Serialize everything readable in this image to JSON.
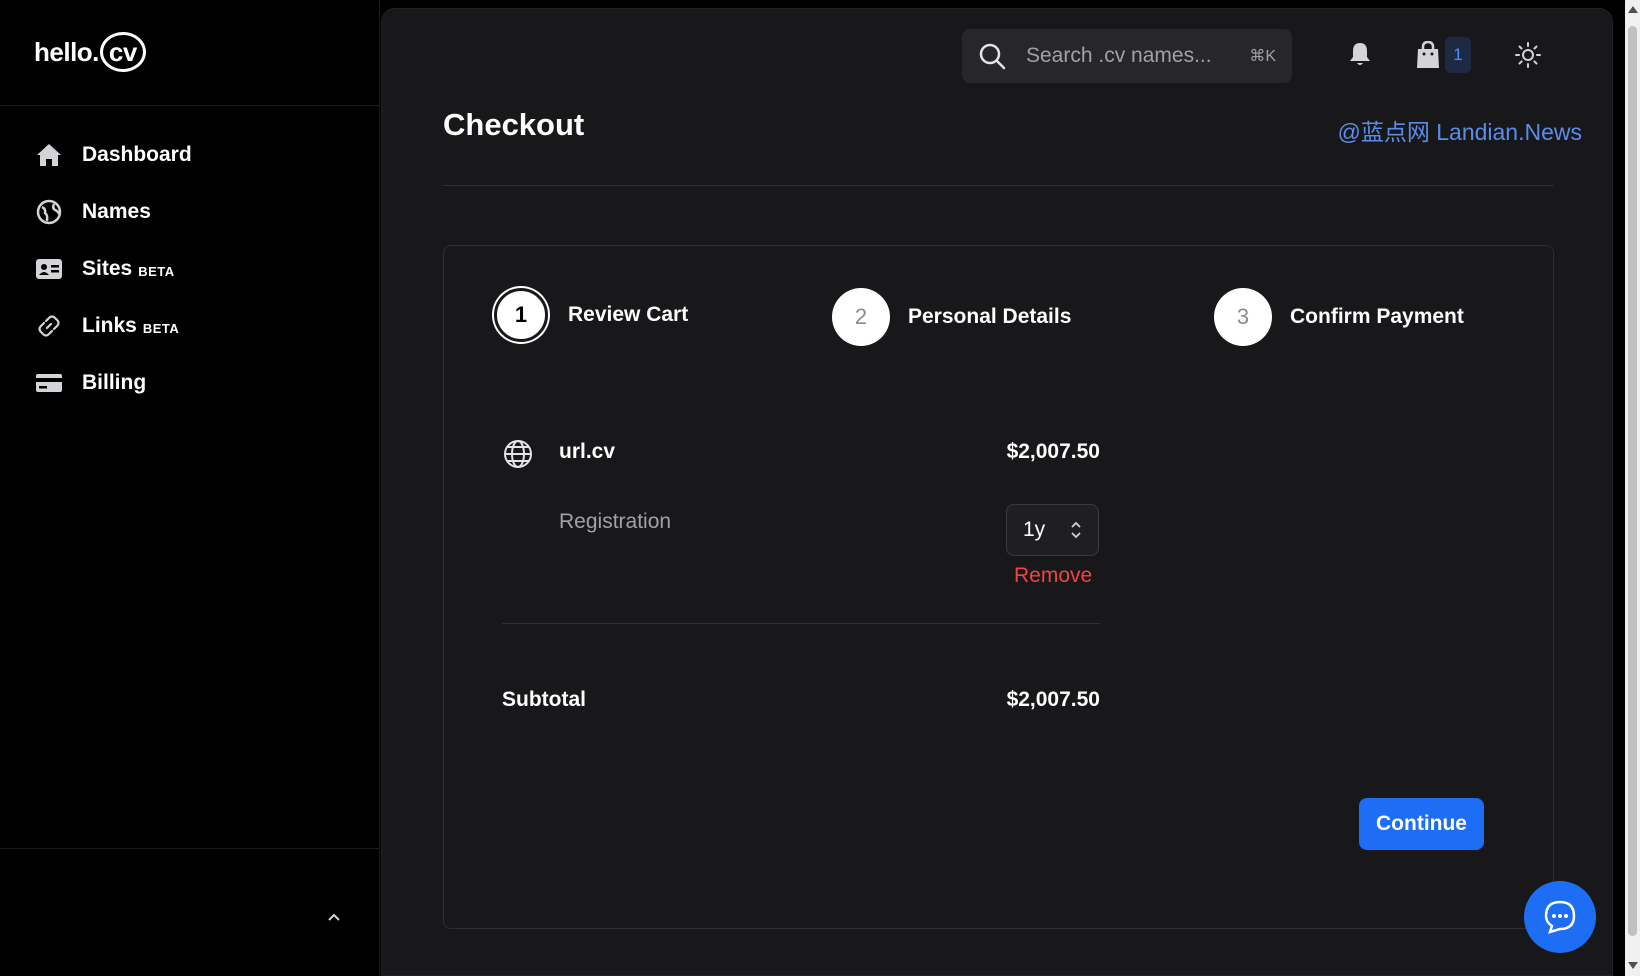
{
  "brand": {
    "logo_text": "hello.",
    "logo_ring_text": "cv"
  },
  "sidebar": {
    "items": [
      {
        "label": "Dashboard",
        "badge": "",
        "icon": "home-icon"
      },
      {
        "label": "Names",
        "badge": "",
        "icon": "globe-icon"
      },
      {
        "label": "Sites",
        "badge": "BETA",
        "icon": "id-card-icon"
      },
      {
        "label": "Links",
        "badge": "BETA",
        "icon": "link-icon"
      },
      {
        "label": "Billing",
        "badge": "",
        "icon": "credit-card-icon"
      }
    ]
  },
  "header": {
    "search_placeholder": "Search .cv names...",
    "search_shortcut": "⌘K",
    "cart_count": "1"
  },
  "page": {
    "title": "Checkout",
    "watermark": "@蓝点网 Landian.News"
  },
  "steps": [
    {
      "number": "1",
      "label": "Review Cart",
      "active": true
    },
    {
      "number": "2",
      "label": "Personal Details",
      "active": false
    },
    {
      "number": "3",
      "label": "Confirm Payment",
      "active": false
    }
  ],
  "cart": {
    "item_name": "url.cv",
    "item_price": "$2,007.50",
    "registration_label": "Registration",
    "registration_value": "1y",
    "remove_label": "Remove",
    "subtotal_label": "Subtotal",
    "subtotal_value": "$2,007.50"
  },
  "actions": {
    "continue_label": "Continue"
  },
  "colors": {
    "accent": "#1d6ef5",
    "danger": "#ef4444",
    "panel": "#18181b"
  }
}
